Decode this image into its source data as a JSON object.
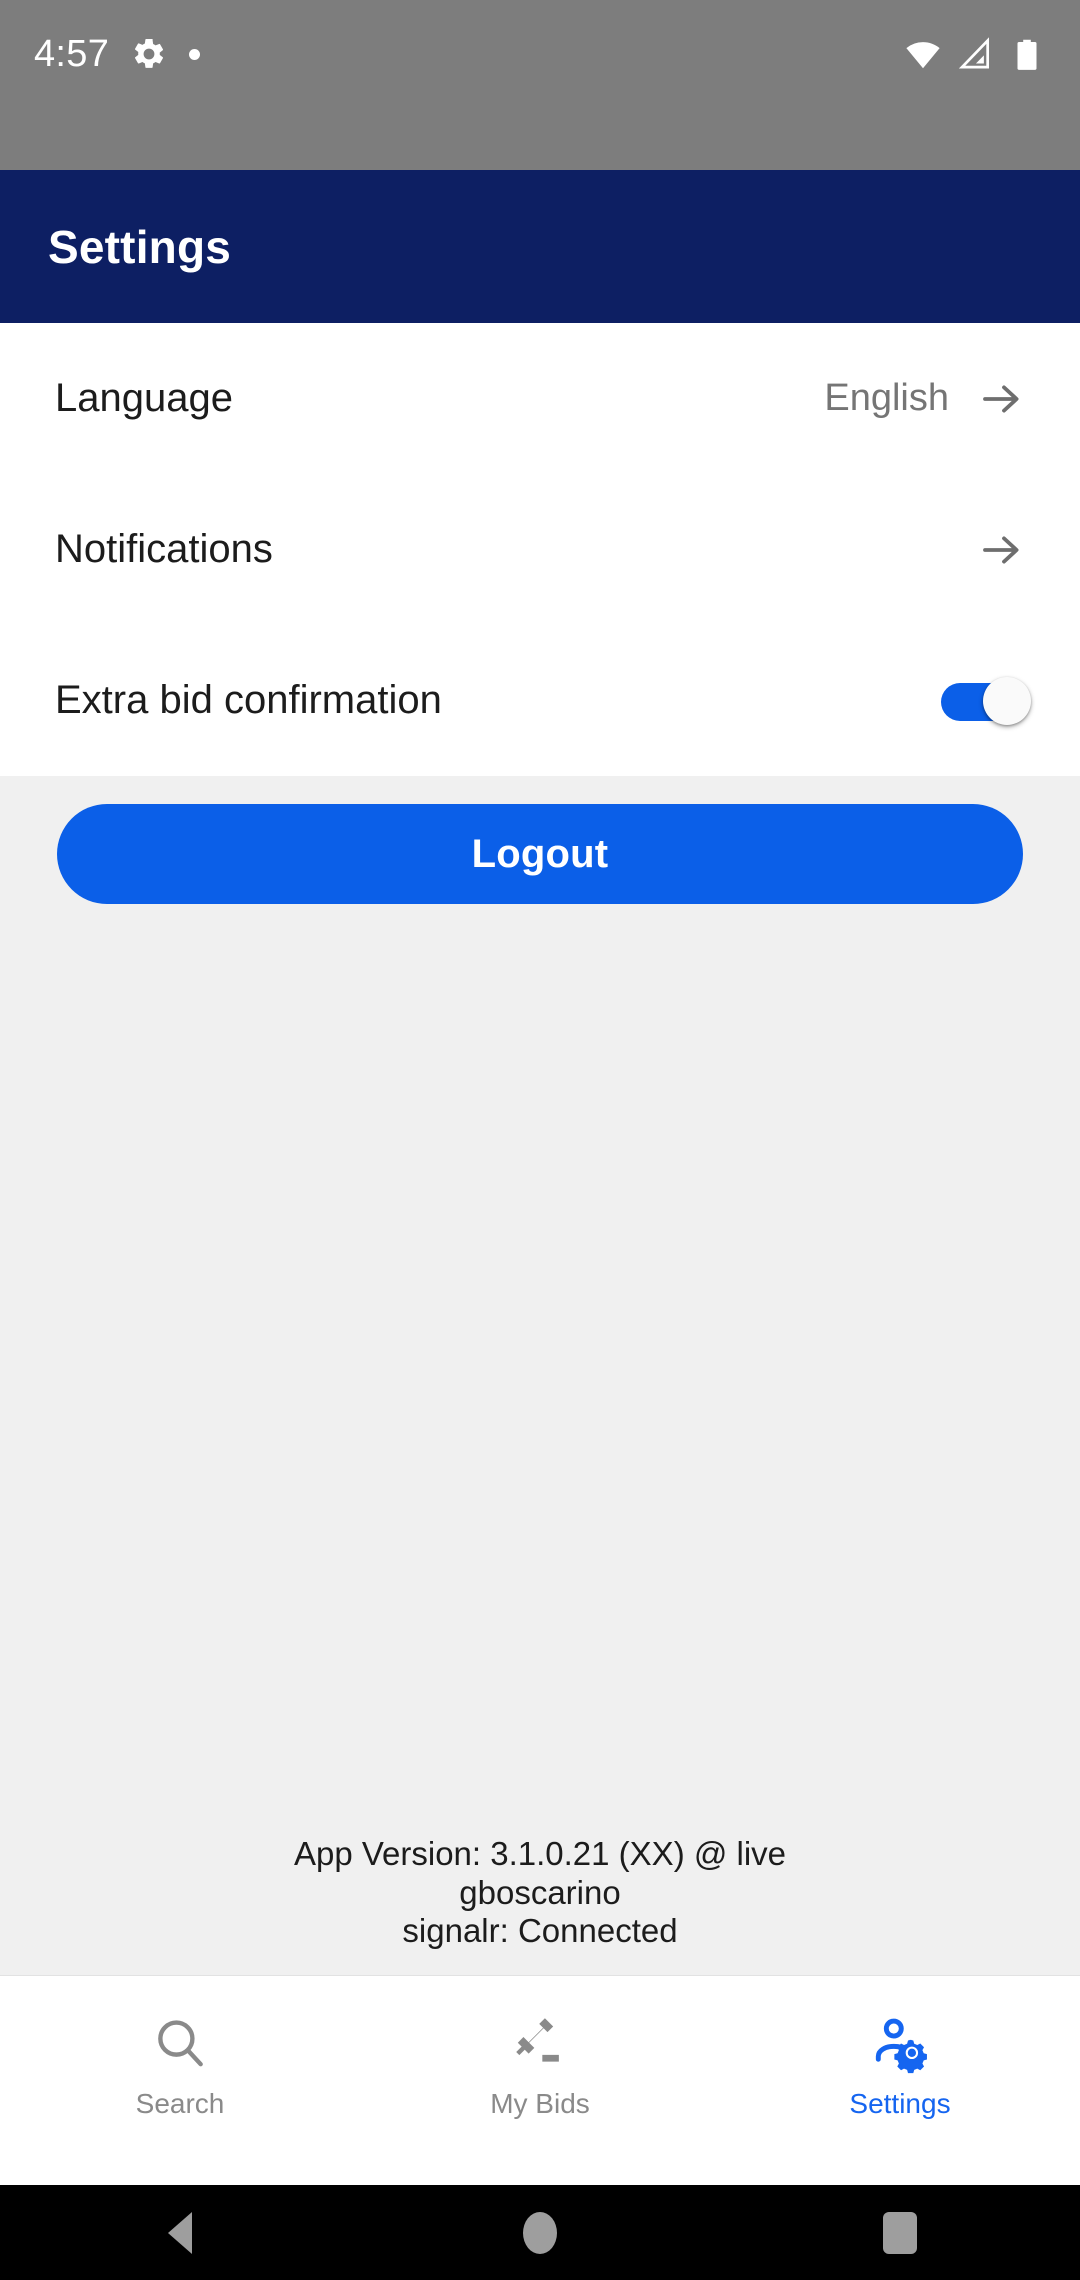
{
  "status_bar": {
    "time": "4:57",
    "left_icons": [
      "gear-icon",
      "dot-indicator"
    ],
    "right_icons": [
      "wifi-icon",
      "cellular-signal-icon",
      "battery-icon"
    ],
    "background_color": "#7d7d7d"
  },
  "app_bar": {
    "title": "Settings",
    "background_color": "#0d1f63",
    "text_color": "#ffffff"
  },
  "settings": {
    "rows": [
      {
        "label": "Language",
        "value": "English",
        "control": "arrow"
      },
      {
        "label": "Notifications",
        "value": "",
        "control": "arrow"
      },
      {
        "label": "Extra bid confirmation",
        "value": "",
        "control": "toggle",
        "toggle_on": true
      }
    ]
  },
  "actions": {
    "logout_label": "Logout",
    "logout_color": "#0b5fe8"
  },
  "footer": {
    "version": "App Version: 3.1.0.21 (XX) @ live",
    "username": "gboscarino",
    "connection": "signalr: Connected"
  },
  "bottom_nav": {
    "items": [
      {
        "label": "Search",
        "icon": "search-icon",
        "active": false
      },
      {
        "label": "My Bids",
        "icon": "gavel-icon",
        "active": false
      },
      {
        "label": "Settings",
        "icon": "manage-accounts-icon",
        "active": true
      }
    ],
    "active_color": "#1565f0",
    "inactive_color": "#8a8a8a"
  },
  "android_nav": {
    "buttons": [
      "back-button",
      "home-button",
      "recents-button"
    ]
  }
}
